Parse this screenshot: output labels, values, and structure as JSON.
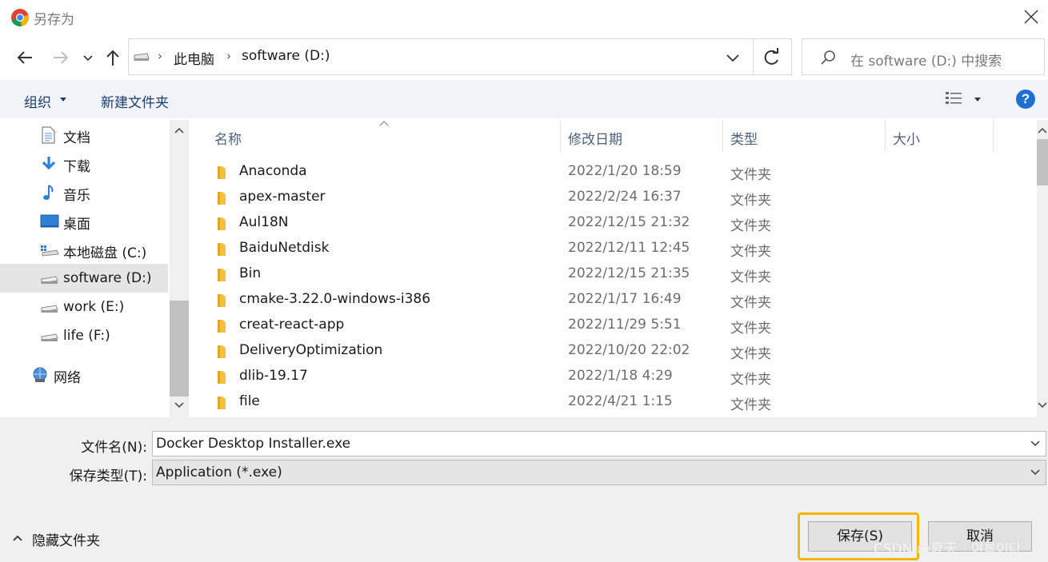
{
  "window": {
    "title": "另存为",
    "accent_color": "#1f6fd1",
    "highlight_color": "#f5b400"
  },
  "address": {
    "breadcrumb": [
      "此电脑",
      "software (D:)"
    ],
    "search_placeholder": "在 software (D:) 中搜索"
  },
  "toolbar": {
    "organize_label": "组织",
    "new_folder_label": "新建文件夹",
    "help_label": "?"
  },
  "nav": {
    "items": [
      {
        "label": "文档",
        "icon": "document-icon"
      },
      {
        "label": "下载",
        "icon": "download-icon"
      },
      {
        "label": "音乐",
        "icon": "music-icon"
      },
      {
        "label": "桌面",
        "icon": "desktop-icon"
      },
      {
        "label": "本地磁盘 (C:)",
        "icon": "windows-drive-icon"
      },
      {
        "label": "software (D:)",
        "icon": "drive-icon",
        "selected": true
      },
      {
        "label": "work (E:)",
        "icon": "drive-icon"
      },
      {
        "label": "life (F:)",
        "icon": "drive-icon"
      },
      {
        "label": "网络",
        "icon": "network-icon"
      }
    ]
  },
  "files": {
    "columns": [
      "名称",
      "修改日期",
      "类型",
      "大小"
    ],
    "rows": [
      {
        "name": "Anaconda",
        "date": "2022/1/20 18:59",
        "type": "文件夹"
      },
      {
        "name": "apex-master",
        "date": "2022/2/24 16:37",
        "type": "文件夹"
      },
      {
        "name": "Aul18N",
        "date": "2022/12/15 21:32",
        "type": "文件夹"
      },
      {
        "name": "BaiduNetdisk",
        "date": "2022/12/11 12:45",
        "type": "文件夹"
      },
      {
        "name": "Bin",
        "date": "2022/12/15 21:35",
        "type": "文件夹"
      },
      {
        "name": "cmake-3.22.0-windows-i386",
        "date": "2022/1/17 16:49",
        "type": "文件夹"
      },
      {
        "name": "creat-react-app",
        "date": "2022/11/29 5:51",
        "type": "文件夹"
      },
      {
        "name": "DeliveryOptimization",
        "date": "2022/10/20 22:02",
        "type": "文件夹"
      },
      {
        "name": "dlib-19.17",
        "date": "2022/1/18 4:29",
        "type": "文件夹"
      },
      {
        "name": "file",
        "date": "2022/4/21 1:15",
        "type": "文件夹"
      }
    ]
  },
  "form": {
    "filename_label": "文件名(N):",
    "filename_value": "Docker Desktop Installer.exe",
    "filetype_label": "保存类型(T):",
    "filetype_value": "Application (*.exe)"
  },
  "footer": {
    "hide_folders_label": "隐藏文件夹",
    "save_label": "保存(S)",
    "cancel_label": "取消",
    "watermark": "CSDN @夏天｜여름이다"
  }
}
